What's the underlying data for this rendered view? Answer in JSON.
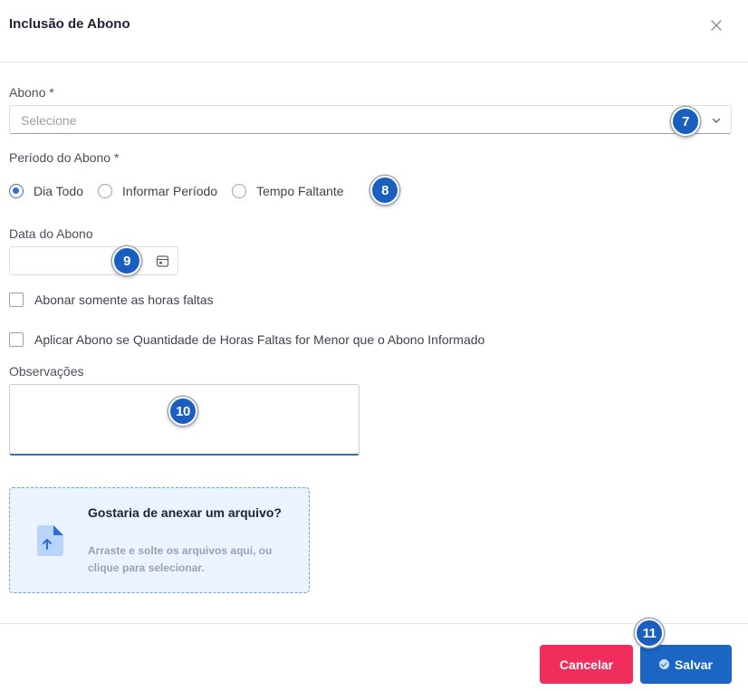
{
  "dialog": {
    "title": "Inclusão de Abono"
  },
  "abono": {
    "label": "Abono *",
    "placeholder": "Selecione"
  },
  "periodo": {
    "label": "Período do Abono *",
    "options": [
      {
        "label": "Dia Todo",
        "selected": true
      },
      {
        "label": "Informar Período",
        "selected": false
      },
      {
        "label": "Tempo Faltante",
        "selected": false
      }
    ]
  },
  "data_abono": {
    "label": "Data do Abono",
    "value": ""
  },
  "checkboxes": [
    {
      "label": "Abonar somente as horas faltas",
      "checked": false
    },
    {
      "label": "Aplicar Abono se Quantidade de Horas Faltas for Menor que o Abono Informado",
      "checked": false
    }
  ],
  "observacoes": {
    "label": "Observações",
    "value": ""
  },
  "upload": {
    "title": "Gostaria de anexar um arquivo?",
    "subtitle": "Arraste e solte os arquivos aqui, ou clique para selecionar."
  },
  "footer": {
    "cancel_label": "Cancelar",
    "save_label": "Salvar"
  },
  "markers": [
    "7",
    "8",
    "9",
    "10",
    "11"
  ],
  "colors": {
    "primary": "#1a66c2",
    "danger": "#ef2e5d",
    "radio_selected": "#2b6fd6",
    "upload_bg": "#eaf3fe",
    "marker": "#1a5fbf"
  }
}
